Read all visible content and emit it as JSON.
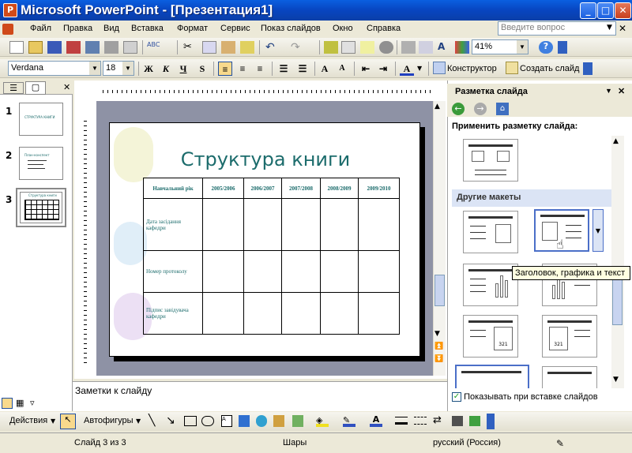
{
  "window": {
    "title": "Microsoft PowerPoint - [Презентация1]",
    "logo": "P"
  },
  "menu": [
    "Файл",
    "Правка",
    "Вид",
    "Вставка",
    "Формат",
    "Сервис",
    "Показ слайдов",
    "Окно",
    "Справка"
  ],
  "help_placeholder": "Введите вопрос",
  "standard_toolbar": {
    "zoom": "41%"
  },
  "format_toolbar": {
    "font": "Verdana",
    "size": "18",
    "bold": "Ж",
    "italic": "К",
    "underline": "Ч",
    "shadow": "S",
    "designer": "Конструктор",
    "new_slide": "Создать слайд"
  },
  "thumbnails": [
    {
      "num": "1",
      "text": "СТРУКТУРА КНИГИ"
    },
    {
      "num": "2",
      "text": "План-конспект"
    },
    {
      "num": "3",
      "text": "Структура книги"
    }
  ],
  "slide": {
    "title": "Структура книги",
    "headers": [
      "Навчальний рік",
      "2005/2006",
      "2006/2007",
      "2007/2008",
      "2008/2009",
      "2009/2010"
    ],
    "rows": [
      "Дата засідання кафедри",
      "Номер протоколу",
      "Підпис завідувача кафедри"
    ]
  },
  "notes_placeholder": "Заметки к слайду",
  "task_pane": {
    "title": "Разметка слайда",
    "apply_label": "Применить разметку слайда:",
    "other_layouts": "Другие макеты",
    "tooltip": "Заголовок, графика и текст",
    "show_on_insert": "Показывать при вставке слайдов",
    "badge": "321"
  },
  "drawing": {
    "actions": "Действия",
    "autoshapes": "Автофигуры"
  },
  "status": {
    "slide": "Слайд 3 из 3",
    "design": "Шары",
    "language": "русский (Россия)"
  }
}
